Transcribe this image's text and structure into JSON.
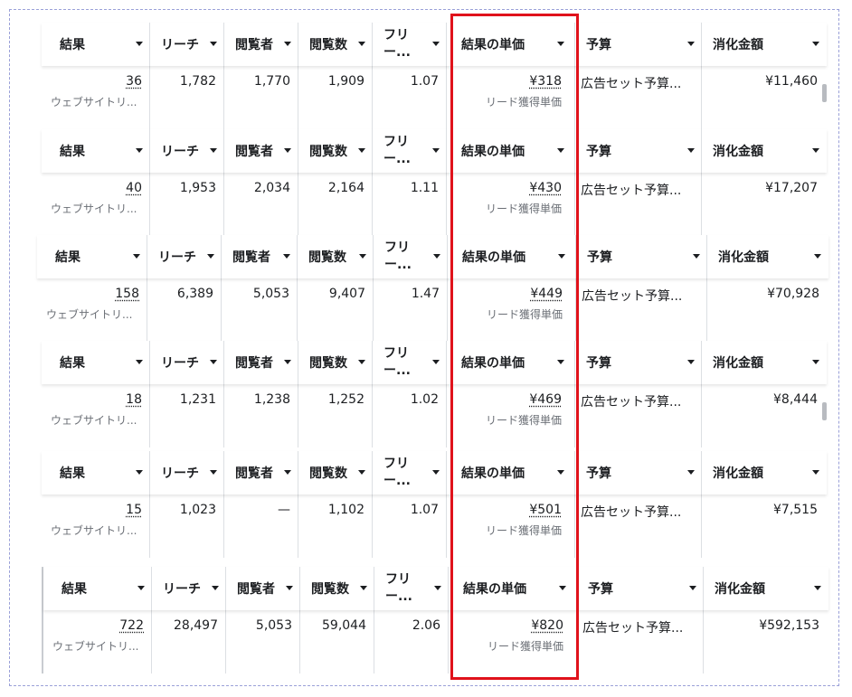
{
  "columns": [
    {
      "key": "results",
      "label": "結果"
    },
    {
      "key": "reach",
      "label": "リーチ"
    },
    {
      "key": "viewers",
      "label": "閲覧者"
    },
    {
      "key": "views",
      "label": "閲覧数"
    },
    {
      "key": "frequency",
      "label": "フリー..."
    },
    {
      "key": "cost_per_result",
      "label": "結果の単価"
    },
    {
      "key": "budget",
      "label": "予算"
    },
    {
      "key": "amount_spent",
      "label": "消化金額"
    }
  ],
  "result_sub": "ウェブサイトリ...",
  "cpr_sub": "リード獲得単価",
  "budget_text": "広告セット予算...",
  "tables": [
    {
      "results": "36",
      "reach": "1,782",
      "viewers": "1,770",
      "views": "1,909",
      "frequency": "1.07",
      "cost_per_result": "¥318",
      "amount_spent": "¥11,460"
    },
    {
      "results": "40",
      "reach": "1,953",
      "viewers": "2,034",
      "views": "2,164",
      "frequency": "1.11",
      "cost_per_result": "¥430",
      "amount_spent": "¥17,207"
    },
    {
      "results": "158",
      "reach": "6,389",
      "viewers": "5,053",
      "views": "9,407",
      "frequency": "1.47",
      "cost_per_result": "¥449",
      "amount_spent": "¥70,928"
    },
    {
      "results": "18",
      "reach": "1,231",
      "viewers": "1,238",
      "views": "1,252",
      "frequency": "1.02",
      "cost_per_result": "¥469",
      "amount_spent": "¥8,444"
    },
    {
      "results": "15",
      "reach": "1,023",
      "viewers": "—",
      "views": "1,102",
      "frequency": "1.07",
      "cost_per_result": "¥501",
      "amount_spent": "¥7,515"
    },
    {
      "results": "722",
      "reach": "28,497",
      "viewers": "5,053",
      "views": "59,044",
      "frequency": "2.06",
      "cost_per_result": "¥820",
      "amount_spent": "¥592,153"
    }
  ]
}
